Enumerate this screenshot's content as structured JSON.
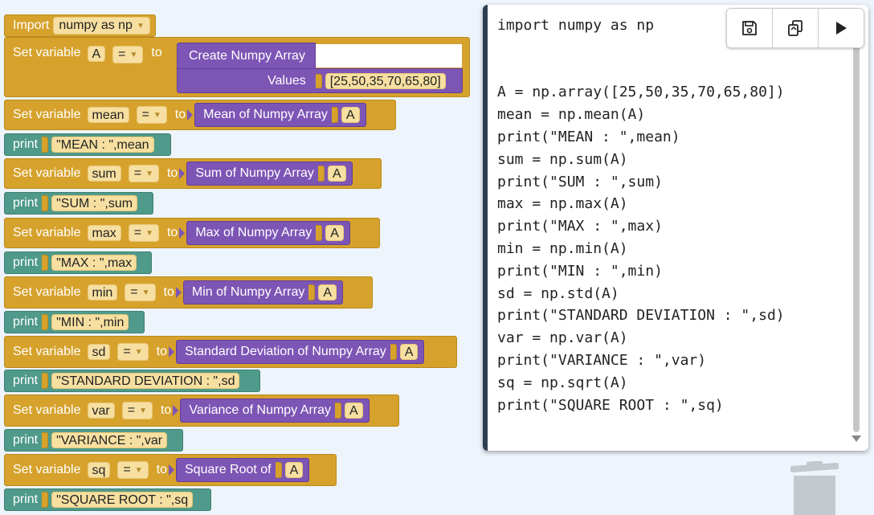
{
  "blocks": {
    "import": {
      "label": "Import",
      "module": "numpy as np"
    },
    "create": {
      "set_label": "Set variable",
      "var": "A",
      "op": "=",
      "to": "to",
      "func": "Create Numpy Array",
      "values_label": "Values",
      "values": "[25,50,35,70,65,80]"
    },
    "mean": {
      "set_label": "Set variable",
      "var": "mean",
      "op": "=",
      "to": "to",
      "func": "Mean of Numpy Array",
      "arg": "A"
    },
    "print_mean": {
      "label": "print",
      "text": "\"MEAN : \",mean"
    },
    "sum": {
      "set_label": "Set variable",
      "var": "sum",
      "op": "=",
      "to": "to",
      "func": "Sum of Numpy Array",
      "arg": "A"
    },
    "print_sum": {
      "label": "print",
      "text": "\"SUM : \",sum"
    },
    "max": {
      "set_label": "Set variable",
      "var": "max",
      "op": "=",
      "to": "to",
      "func": "Max of Numpy Array",
      "arg": "A"
    },
    "print_max": {
      "label": "print",
      "text": "\"MAX : \",max"
    },
    "min": {
      "set_label": "Set variable",
      "var": "min",
      "op": "=",
      "to": "to",
      "func": "Min of Numpy Array",
      "arg": "A"
    },
    "print_min": {
      "label": "print",
      "text": "\"MIN : \",min"
    },
    "sd": {
      "set_label": "Set variable",
      "var": "sd",
      "op": "=",
      "to": "to",
      "func": "Standard Deviation of Numpy Array",
      "arg": "A"
    },
    "print_sd": {
      "label": "print",
      "text": "\"STANDARD DEVIATION : \",sd"
    },
    "var": {
      "set_label": "Set variable",
      "var": "var",
      "op": "=",
      "to": "to",
      "func": "Variance of Numpy Array",
      "arg": "A"
    },
    "print_var": {
      "label": "print",
      "text": "\"VARIANCE : \",var"
    },
    "sq": {
      "set_label": "Set variable",
      "var": "sq",
      "op": "=",
      "to": "to",
      "func": "Square Root of",
      "arg": "A"
    },
    "print_sq": {
      "label": "print",
      "text": "\"SQUARE ROOT : \",sq"
    }
  },
  "code": "import numpy as np\n\n\nA = np.array([25,50,35,70,65,80])\nmean = np.mean(A)\nprint(\"MEAN : \",mean)\nsum = np.sum(A)\nprint(\"SUM : \",sum)\nmax = np.max(A)\nprint(\"MAX : \",max)\nmin = np.min(A)\nprint(\"MIN : \",min)\nsd = np.std(A)\nprint(\"STANDARD DEVIATION : \",sd)\nvar = np.var(A)\nprint(\"VARIANCE : \",var)\nsq = np.sqrt(A)\nprint(\"SQUARE ROOT : \",sq)",
  "toolbar": {
    "icons": [
      "save-icon",
      "copy-icon",
      "play-icon"
    ]
  },
  "zoom": {
    "zoom_in": "+",
    "zoom_out": "−"
  },
  "colors": {
    "variable_block": "#d6a22c",
    "print_block": "#4f9a8a",
    "numpy_block": "#7d55b5",
    "field": "#f6dfa0"
  }
}
